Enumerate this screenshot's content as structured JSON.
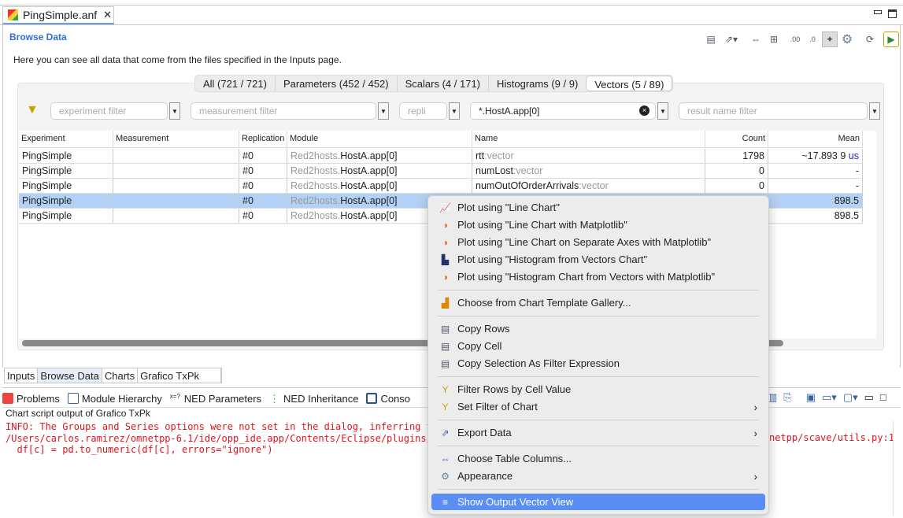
{
  "editor_tab": {
    "title": "PingSimple.anf",
    "close": "✕"
  },
  "page": {
    "title": "Browse Data",
    "description": "Here you can see all data that come from the files specified in the Inputs page."
  },
  "tabs": [
    "All (721 / 721)",
    "Parameters (452 / 452)",
    "Scalars (4 / 171)",
    "Histograms (9 / 9)",
    "Vectors (5 / 89)"
  ],
  "filters": {
    "experiment": "experiment filter",
    "measurement": "measurement filter",
    "replication": "repli",
    "module": "*.HostA.app[0]",
    "name": "result name filter"
  },
  "table": {
    "headers": [
      "Experiment",
      "Measurement",
      "Replication",
      "Module",
      "Name",
      "Count",
      "Mean"
    ],
    "rows": [
      {
        "experiment": "PingSimple",
        "measurement": "",
        "replication": "#0",
        "module_prefix": "Red2hosts.",
        "module": "HostA.app[0]",
        "name": "rtt",
        "suffix": ":vector",
        "count": "1798",
        "mean": "~17.893 9",
        "unit": "us"
      },
      {
        "experiment": "PingSimple",
        "measurement": "",
        "replication": "#0",
        "module_prefix": "Red2hosts.",
        "module": "HostA.app[0]",
        "name": "numLost",
        "suffix": ":vector",
        "count": "0",
        "mean": "-",
        "unit": ""
      },
      {
        "experiment": "PingSimple",
        "measurement": "",
        "replication": "#0",
        "module_prefix": "Red2hosts.",
        "module": "HostA.app[0]",
        "name": "numOutOfOrderArrivals",
        "suffix": ":vector",
        "count": "0",
        "mean": "-",
        "unit": ""
      },
      {
        "experiment": "PingSimple",
        "measurement": "",
        "replication": "#0",
        "module_prefix": "Red2hosts.",
        "module": "HostA.app[0]",
        "name": "",
        "suffix": "",
        "count": "",
        "mean": "898.5",
        "unit": ""
      },
      {
        "experiment": "PingSimple",
        "measurement": "",
        "replication": "#0",
        "module_prefix": "Red2hosts.",
        "module": "HostA.app[0]",
        "name": "",
        "suffix": "",
        "count": "",
        "mean": "898.5",
        "unit": ""
      }
    ]
  },
  "bottom_tabs": [
    "Inputs",
    "Browse Data",
    "Charts",
    "Grafico TxPk"
  ],
  "views": [
    "Problems",
    "Module Hierarchy",
    "NED Parameters",
    "NED Inheritance",
    "Conso"
  ],
  "console": {
    "label": "Chart script output of Grafico TxPk",
    "lines": [
      "INFO: The Groups and Series options were not set in the dialog, inferring t",
      "/Users/carlos.ramirez/omnetpp-6.1/ide/opp_ide.app/Contents/Eclipse/plugins/",
      "  df[c] = pd.to_numeric(df[c], errors=\"ignore\")"
    ],
    "line2_tail": "netpp/scave/utils.py:1"
  },
  "menu": [
    "Plot using \"Line Chart\"",
    "Plot using \"Line Chart with Matplotlib\"",
    "Plot using \"Line Chart on Separate Axes with Matplotlib\"",
    "Plot using \"Histogram from Vectors Chart\"",
    "Plot using \"Histogram Chart from Vectors with Matplotlib\"",
    "Choose from Chart Template Gallery...",
    "Copy Rows",
    "Copy Cell",
    "Copy Selection As Filter Expression",
    "Filter Rows by Cell Value",
    "Set Filter of Chart",
    "Export Data",
    "Choose Table Columns...",
    "Appearance",
    "Show Output Vector View"
  ],
  "colors": {
    "accent": "#2f6fd6",
    "selection": "#b3d1f7",
    "menu_highlight": "#5a8ef2",
    "console_error": "#e0141e"
  }
}
